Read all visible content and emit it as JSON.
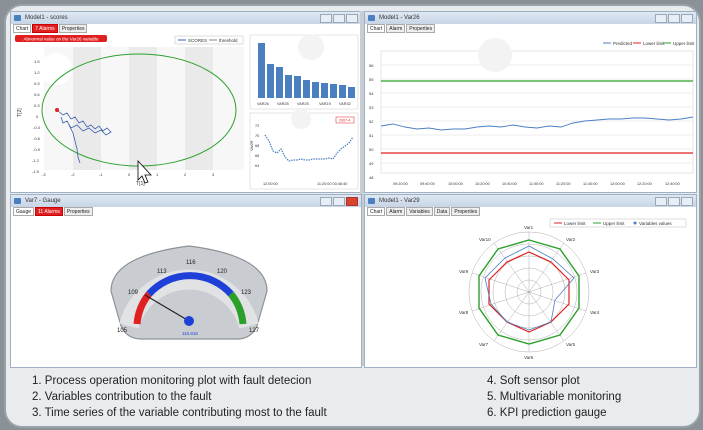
{
  "window1": {
    "title": "Model1 - scores",
    "tabs": [
      "Chart",
      "7 Alarms",
      "Properties"
    ],
    "alarm_label": "Abnormal value on the Var26 variable",
    "legend": [
      "SCORES",
      "threshold"
    ],
    "y_ticks": [
      "1.5",
      "1.2",
      "0.9",
      "0.6",
      "0.3",
      "0",
      "-0.3",
      "-0.6",
      "-0.9",
      "-1.2",
      "-1.5"
    ],
    "x_ticks": [
      "-3",
      "-2",
      "-1",
      "0",
      "1",
      "2",
      "3"
    ],
    "ylabel": "T[2]",
    "xlabel": "T[1]",
    "bar_chart": {
      "categories": [
        "VAR26",
        "VAR25",
        "VAR25",
        "VAR19",
        "VAR32"
      ],
      "values": [
        100,
        62,
        56,
        42,
        40,
        33,
        30,
        28,
        26,
        25,
        22,
        20,
        18
      ]
    },
    "ts_chart": {
      "ylabel": "Var26",
      "y_ticks": [
        "72",
        "70",
        "68",
        "66",
        "64"
      ],
      "x_ticks": [
        "12:00:00",
        "11:20:00 03:46:40"
      ],
      "tag": "2007-4"
    }
  },
  "window2": {
    "title": "Model1 - Var26",
    "tabs": [
      "Chart",
      "Alarm",
      "Properties"
    ],
    "legend": [
      "Predicted",
      "Lower limit",
      "Upper limit"
    ],
    "y_ticks": [
      "56",
      "55",
      "54",
      "53",
      "52",
      "51",
      "50",
      "49",
      "48"
    ],
    "x_ticks": [
      "09:20:00",
      "09:40:00",
      "10:00:00",
      "10:20:00",
      "10:40:00",
      "11:00:00",
      "11:20:00",
      "11:40:00",
      "12:00:00",
      "12:20:00",
      "12:40:00"
    ],
    "upper_limit": 55,
    "lower_limit": 49.5
  },
  "window3": {
    "title": "Var7 - Gauge",
    "tabs": [
      "Gauge",
      "11 Alarms",
      "Properties"
    ],
    "scale": [
      "105",
      "109",
      "113",
      "116",
      "120",
      "123",
      "127"
    ],
    "value_label": "110.816",
    "value": 110.816
  },
  "window4": {
    "title": "Model1 - Var29",
    "tabs": [
      "Chart",
      "Alarm",
      "Variables",
      "Data",
      "Properties"
    ],
    "legend": [
      "Lower limit",
      "Upper limit",
      "Variables values"
    ],
    "axes": [
      "Var1",
      "Var2",
      "Var3",
      "Var4",
      "Var5",
      "Var6",
      "Var7",
      "Var8",
      "Var9",
      "Var10"
    ]
  },
  "caption": {
    "items": [
      "1. Process operation monitoring plot with fault detecion",
      "2. Variables contribution to the fault",
      "3. Time series of the variable contributing most to the fault",
      "4. Soft sensor plot",
      "5. Multivariable monitoring",
      "6. KPI prediction gauge"
    ]
  },
  "colors": {
    "accent_blue": "#4a7fc0",
    "alarm_red": "#e02020",
    "limit_green": "#2aa02a",
    "limit_red": "#e02020"
  }
}
